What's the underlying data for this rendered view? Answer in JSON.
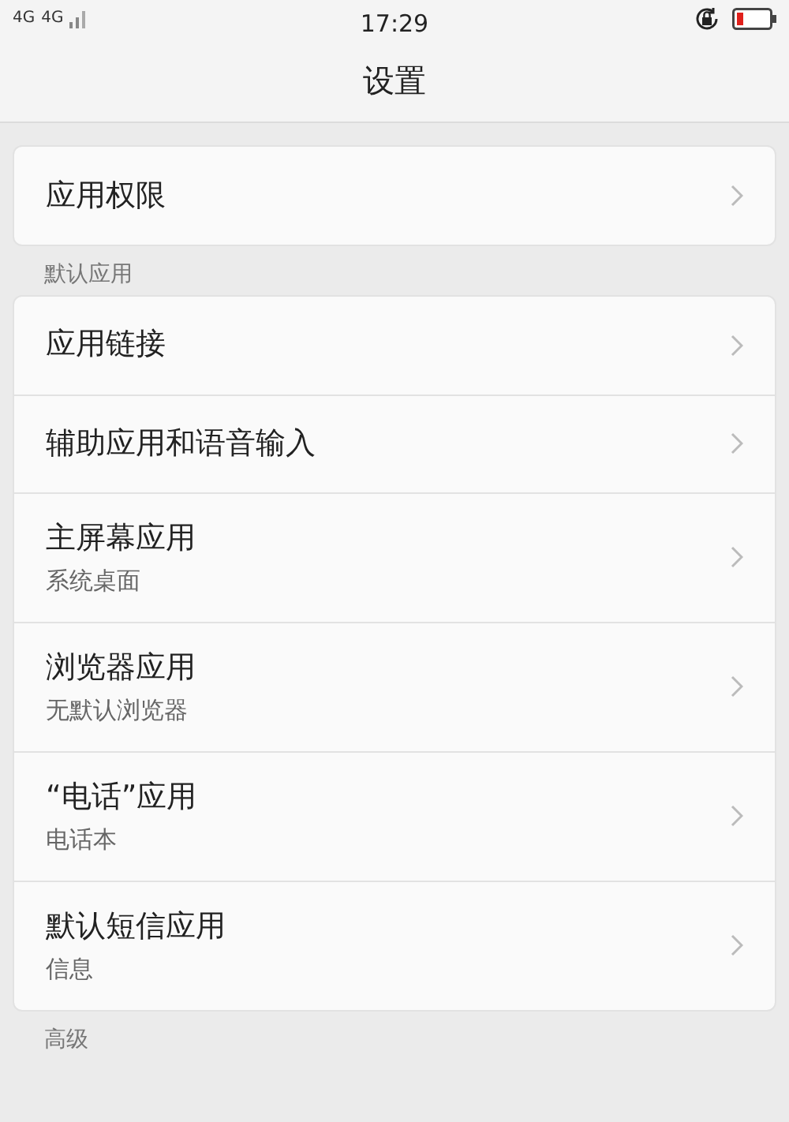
{
  "status_bar": {
    "network_1": "4G",
    "network_2": "4G",
    "time": "17:29"
  },
  "title": "设置",
  "sections": [
    {
      "items": [
        {
          "title": "应用权限"
        }
      ]
    },
    {
      "header": "默认应用",
      "items": [
        {
          "title": "应用链接"
        },
        {
          "title": "辅助应用和语音输入"
        },
        {
          "title": "主屏幕应用",
          "subtitle": "系统桌面"
        },
        {
          "title": "浏览器应用",
          "subtitle": "无默认浏览器"
        },
        {
          "title": "“电话”应用",
          "subtitle": "电话本"
        },
        {
          "title": "默认短信应用",
          "subtitle": "信息"
        }
      ]
    },
    {
      "header": "高级"
    }
  ]
}
